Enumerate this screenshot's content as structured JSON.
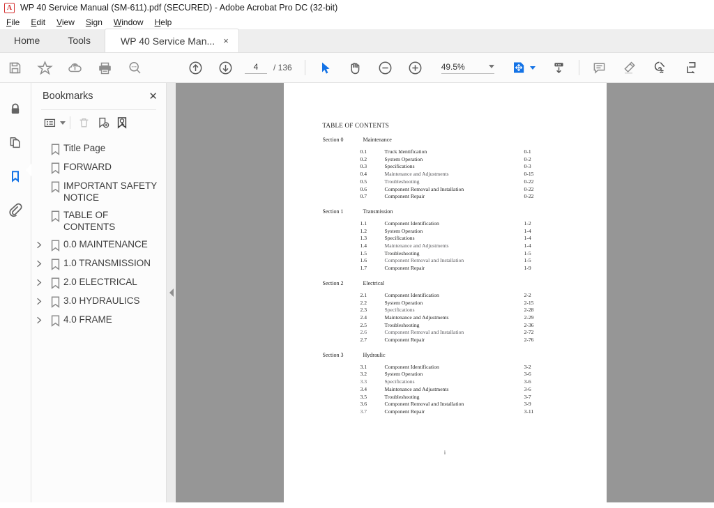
{
  "window": {
    "title": "WP 40 Service Manual (SM-611).pdf (SECURED) - Adobe Acrobat Pro DC (32-bit)",
    "logo_glyph": "A"
  },
  "menubar": {
    "items": [
      {
        "label": "File",
        "mnemonic": "F"
      },
      {
        "label": "Edit",
        "mnemonic": "E"
      },
      {
        "label": "View",
        "mnemonic": "V"
      },
      {
        "label": "Sign",
        "mnemonic": "S"
      },
      {
        "label": "Window",
        "mnemonic": "W"
      },
      {
        "label": "Help",
        "mnemonic": "H"
      }
    ]
  },
  "tabs": {
    "items": [
      {
        "label": "Home",
        "active": false,
        "closable": false
      },
      {
        "label": "Tools",
        "active": false,
        "closable": false
      },
      {
        "label": "WP 40 Service Man...",
        "active": true,
        "closable": true
      }
    ],
    "close_glyph": "×"
  },
  "toolbar": {
    "buttons": [
      {
        "name": "save-file-button",
        "icon": "save-icon"
      },
      {
        "name": "add-to-favorites-button",
        "icon": "star-icon"
      },
      {
        "name": "upload-to-cloud-button",
        "icon": "cloud-upload-icon"
      },
      {
        "name": "print-file-button",
        "icon": "print-icon"
      },
      {
        "name": "find-text-button",
        "icon": "search-icon"
      },
      {
        "name": "previous-page-button",
        "icon": "arrow-up-circle-icon"
      },
      {
        "name": "next-page-button",
        "icon": "arrow-down-circle-icon"
      }
    ],
    "page_current": "4",
    "page_total": "/ 136",
    "tool_select": "select-cursor-icon",
    "tool_pan": "hand-icon",
    "zoom_out": "zoom-out-icon",
    "zoom_in": "zoom-in-icon",
    "zoom_level": "49.5%",
    "fit_page_icon": "fit-page-icon",
    "scroll_mode_icon": "scroll-mode-icon",
    "comment_icon": "comment-icon",
    "highlight_icon": "highlighter-icon",
    "sign_icon": "sign-icon",
    "stamp_icon": "stamp-icon",
    "accent_color": "#1473e6",
    "icon_color": "#8d8d8d"
  },
  "rail": {
    "items": [
      {
        "name": "sidebar-security-lock",
        "icon": "lock-icon",
        "active": false
      },
      {
        "name": "sidebar-page-thumbnails",
        "icon": "pages-icon",
        "active": false
      },
      {
        "name": "sidebar-bookmarks",
        "icon": "bookmark-icon",
        "active": true
      },
      {
        "name": "sidebar-attachments",
        "icon": "paperclip-icon",
        "active": false
      }
    ]
  },
  "panel": {
    "title": "Bookmarks",
    "close_glyph": "✕",
    "tools": [
      {
        "name": "bookmark-options-menu",
        "icon": "list-options-icon"
      },
      {
        "name": "delete-bookmark-button",
        "icon": "trash-icon"
      },
      {
        "name": "new-bookmark-button",
        "icon": "bookmark-add-icon"
      },
      {
        "name": "select-bookmark-button",
        "icon": "bookmark-pointer-icon"
      }
    ],
    "bookmarks": [
      {
        "label": "Title Page",
        "expandable": false
      },
      {
        "label": "FORWARD",
        "expandable": false
      },
      {
        "label": "IMPORTANT SAFETY NOTICE",
        "expandable": false
      },
      {
        "label": "TABLE OF CONTENTS",
        "expandable": false
      },
      {
        "label": "0.0 MAINTENANCE",
        "expandable": true
      },
      {
        "label": "1.0 TRANSMISSION",
        "expandable": true
      },
      {
        "label": "2.0  ELECTRICAL",
        "expandable": true
      },
      {
        "label": "3.0  HYDRAULICS",
        "expandable": true
      },
      {
        "label": "4.0  FRAME",
        "expandable": true
      }
    ],
    "collapse_handle_icon": "chevron-left-icon"
  },
  "document": {
    "background_color": "#969696",
    "toc_title": "TABLE OF CONTENTS",
    "folio": "i",
    "sections": [
      {
        "section_label": "Section 0",
        "section_name": "Maintenance",
        "rows": [
          {
            "num": "0.1",
            "title": "Truck Identification",
            "page": "0-1"
          },
          {
            "num": "0.2",
            "title": "System Operation",
            "page": "0-2"
          },
          {
            "num": "0.3",
            "title": "Specifications",
            "page": "0-3"
          },
          {
            "num": "0.4",
            "title": "Maintenance and Adjustments",
            "page": "0-15"
          },
          {
            "num": "0.5",
            "title": "Troubleshooting",
            "page": "0-22"
          },
          {
            "num": "0.6",
            "title": "Component Removal and Installation",
            "page": "0-22"
          },
          {
            "num": "0.7",
            "title": "Component Repair",
            "page": "0-22"
          }
        ]
      },
      {
        "section_label": "Section 1",
        "section_name": "Transmission",
        "rows": [
          {
            "num": "1.1",
            "title": "Component Identification",
            "page": "1-2"
          },
          {
            "num": "1.2",
            "title": "System Operation",
            "page": "1-4"
          },
          {
            "num": "1.3",
            "title": "Specifications",
            "page": "1-4"
          },
          {
            "num": "1.4",
            "title": "Maintenance and Adjustments",
            "page": "1-4"
          },
          {
            "num": "1.5",
            "title": "Troubleshooting",
            "page": "1-5"
          },
          {
            "num": "1.6",
            "title": "Component Removal and Installation",
            "page": "1-5"
          },
          {
            "num": "1.7",
            "title": "Component Repair",
            "page": "1-9"
          }
        ]
      },
      {
        "section_label": "Section 2",
        "section_name": "Electrical",
        "rows": [
          {
            "num": "2.1",
            "title": "Component Identification",
            "page": "2-2"
          },
          {
            "num": "2.2",
            "title": "System Operation",
            "page": "2-15"
          },
          {
            "num": "2.3",
            "title": "Specifications",
            "page": "2-28"
          },
          {
            "num": "2.4",
            "title": "Maintenance and Adjustments",
            "page": "2-29"
          },
          {
            "num": "2.5",
            "title": "Troubleshooting",
            "page": "2-36"
          },
          {
            "num": "2.6",
            "title": "Component Removal and Installation",
            "page": "2-72"
          },
          {
            "num": "2.7",
            "title": "Component Repair",
            "page": "2-76"
          }
        ]
      },
      {
        "section_label": "Section 3",
        "section_name": "Hydraulic",
        "rows": [
          {
            "num": "3.1",
            "title": "Component Identification",
            "page": "3-2"
          },
          {
            "num": "3.2",
            "title": "System Operation",
            "page": "3-6"
          },
          {
            "num": "3.3",
            "title": "Specifications",
            "page": "3-6"
          },
          {
            "num": "3.4",
            "title": "Maintenance and Adjustments",
            "page": "3-6"
          },
          {
            "num": "3.5",
            "title": "Troubleshooting",
            "page": "3-7"
          },
          {
            "num": "3.6",
            "title": "Component Removal and Installation",
            "page": "3-9"
          },
          {
            "num": "3.7",
            "title": "Component Repair",
            "page": "3-11"
          }
        ]
      }
    ]
  }
}
